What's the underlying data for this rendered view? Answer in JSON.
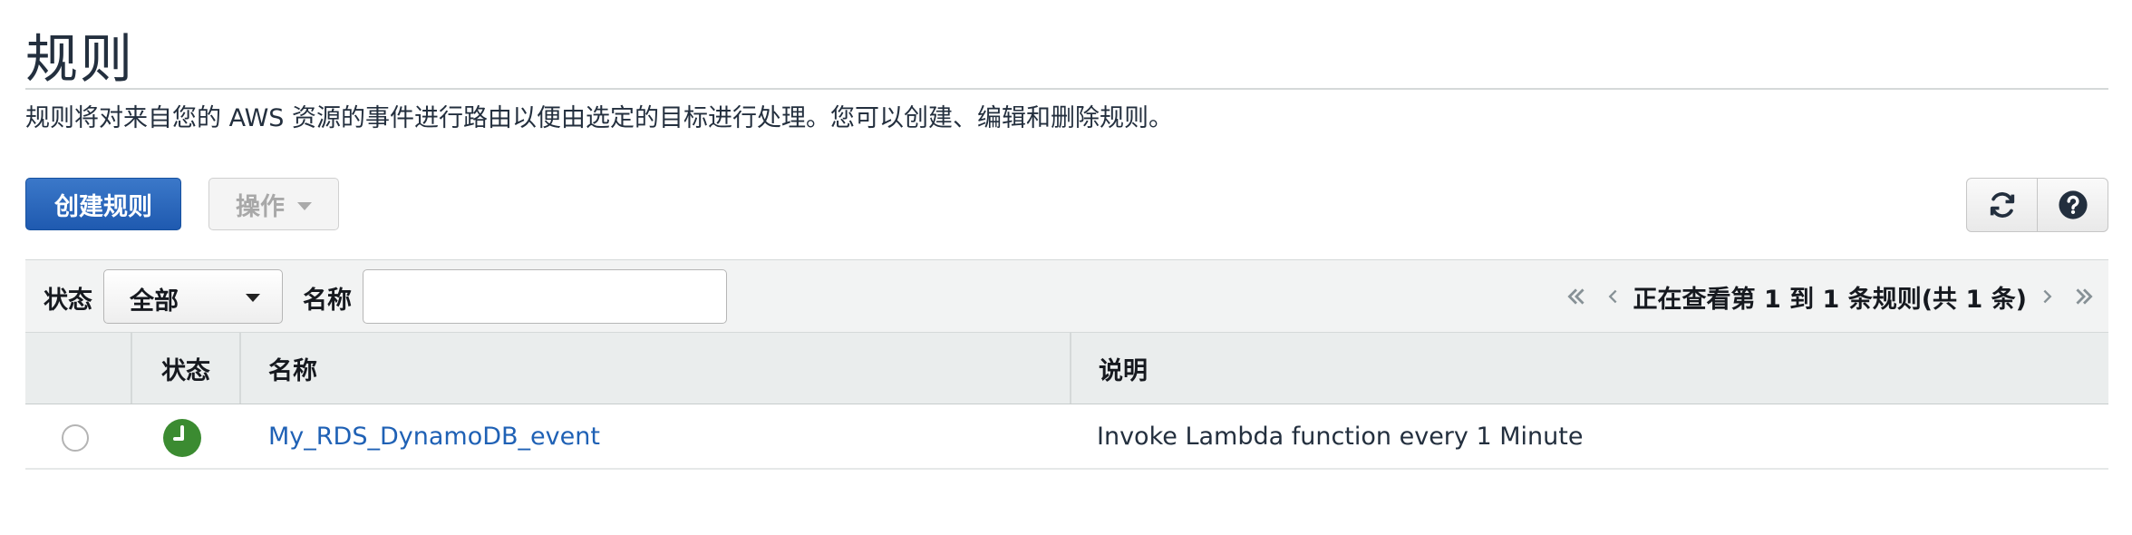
{
  "page": {
    "title": "规则",
    "description": "规则将对来自您的 AWS 资源的事件进行路由以便由选定的目标进行处理。您可以创建、编辑和删除规则。"
  },
  "toolbar": {
    "create_label": "创建规则",
    "actions_label": "操作",
    "refresh_icon": "refresh-icon",
    "help_icon": "help-icon"
  },
  "filters": {
    "status_label": "状态",
    "status_value": "全部",
    "name_label": "名称",
    "name_value": "",
    "pagination_text": "正在查看第 1 到 1 条规则(共 1 条)"
  },
  "table": {
    "columns": [
      "状态",
      "名称",
      "说明"
    ],
    "rows": [
      {
        "selected": false,
        "status_icon": "enabled-clock-icon",
        "status_color": "#3b8b31",
        "name": "My_RDS_DynamoDB_event",
        "description": "Invoke Lambda function every 1 Minute"
      }
    ]
  },
  "colors": {
    "primary_button": "#2a67bd",
    "link": "#1f61b5",
    "status_enabled": "#3b8b31"
  }
}
